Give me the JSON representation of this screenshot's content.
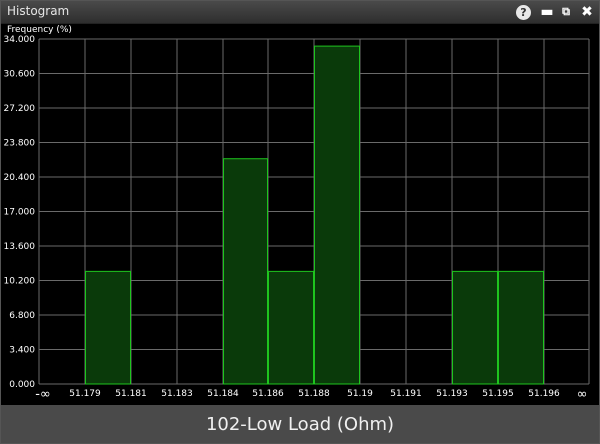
{
  "window": {
    "title": "Histogram",
    "help_icon": "question-circle-icon",
    "minimize_icon": "minimize-icon",
    "restore_icon": "restore-window-icon",
    "close_icon": "close-icon"
  },
  "footer": {
    "label": "102-Low Load (Ohm)"
  },
  "colors": {
    "bar_fill": "#0a3a0a",
    "bar_stroke": "#1ec51e",
    "grid": "#6a6a6a",
    "text": "#ffffff",
    "background": "#000000"
  },
  "chart_data": {
    "type": "bar",
    "ylabel": "Frequency (%)",
    "xlabel": "102-Low Load (Ohm)",
    "ylim": [
      0,
      34
    ],
    "y_ticks": [
      "0.000",
      "3.400",
      "6.800",
      "10.200",
      "13.600",
      "17.000",
      "20.400",
      "23.800",
      "27.200",
      "30.600",
      "34.000"
    ],
    "x_ticks": [
      "51.179",
      "51.181",
      "51.183",
      "51.184",
      "51.186",
      "51.188",
      "51.19",
      "51.191",
      "51.193",
      "51.195",
      "51.196"
    ],
    "x_end_labels": [
      "-∞",
      "∞"
    ],
    "bins": [
      [
        "51.179",
        "51.181",
        11.1
      ],
      [
        "51.181",
        "51.183",
        0
      ],
      [
        "51.183",
        "51.184",
        0
      ],
      [
        "51.184",
        "51.186",
        22.2
      ],
      [
        "51.186",
        "51.188",
        11.1
      ],
      [
        "51.188",
        "51.19",
        33.3
      ],
      [
        "51.19",
        "51.191",
        0
      ],
      [
        "51.191",
        "51.193",
        0
      ],
      [
        "51.193",
        "51.195",
        11.1
      ],
      [
        "51.195",
        "51.196",
        11.1
      ]
    ],
    "grid": true,
    "legend": "none"
  }
}
